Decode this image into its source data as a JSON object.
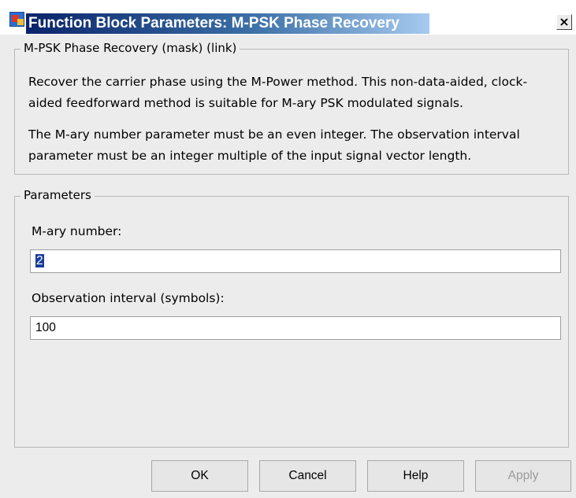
{
  "window": {
    "title": "Function Block Parameters: M-PSK Phase Recovery",
    "close_glyph": "×"
  },
  "mask_group": {
    "legend": "M-PSK Phase Recovery (mask) (link)",
    "paragraph_1_line_1": "Recover the carrier phase using the M-Power method.  This non-data-aided, clock-",
    "paragraph_1_line_2": "aided feedforward method is suitable for M-ary PSK modulated signals.",
    "paragraph_2_line_1": "The M-ary number parameter must be an even integer. The observation interval",
    "paragraph_2_line_2": "parameter must be an integer multiple of the input signal vector length."
  },
  "parameters": {
    "legend": "Parameters",
    "mary_label": "M-ary number:",
    "mary_value": "2",
    "obs_label": "Observation interval (symbols):",
    "obs_value": "100"
  },
  "buttons": {
    "ok": "OK",
    "cancel": "Cancel",
    "help": "Help",
    "apply": "Apply"
  },
  "icons": {
    "app": "simulink-block-icon",
    "close": "close-icon"
  }
}
